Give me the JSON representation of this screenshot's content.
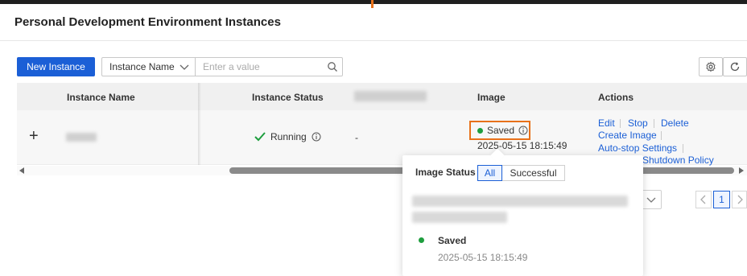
{
  "page": {
    "title": "Personal Development Environment Instances"
  },
  "toolbar": {
    "new_instance_label": "New Instance",
    "filter_field": "Instance Name",
    "search_placeholder": "Enter a value"
  },
  "table": {
    "headers": {
      "name": "Instance Name",
      "status": "Instance Status",
      "image": "Image",
      "actions": "Actions"
    },
    "row": {
      "expand_symbol": "+",
      "status": "Running",
      "col3": "-",
      "image_status": "Saved",
      "image_time": "2025-05-15 18:15:49"
    },
    "actions": {
      "edit": "Edit",
      "stop": "Stop",
      "delete": "Delete",
      "create_image": "Create Image",
      "auto_stop": "Auto-stop Settings",
      "shutdown_policy": "Shutdown Policy"
    }
  },
  "pagination": {
    "current": "1"
  },
  "popover": {
    "title": "Image Status",
    "filter_all": "All",
    "filter_successful": "Successful",
    "entry_status": "Saved",
    "entry_time": "2025-05-15 18:15:49"
  },
  "colors": {
    "primary": "#1b5fd6",
    "success": "#1e9e3e",
    "highlight": "#e8711a"
  }
}
